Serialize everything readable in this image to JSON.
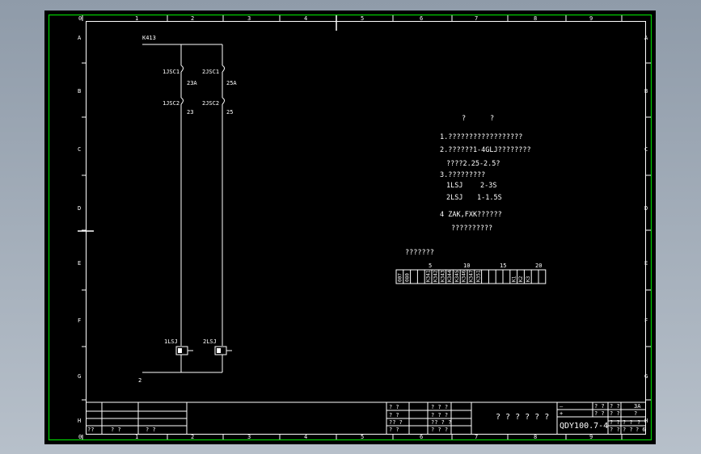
{
  "drawing": {
    "border_color": "#00c800",
    "line_color": "#ffffff",
    "background": "#000000",
    "col_numbers_top": [
      "0",
      "1",
      "2",
      "3",
      "4",
      "5",
      "6",
      "7",
      "8",
      "9"
    ],
    "col_numbers_bottom": [
      "0",
      "1",
      "2",
      "3",
      "4",
      "5",
      "6",
      "7",
      "8",
      "9"
    ],
    "row_letters_left": [
      "A",
      "B",
      "C",
      "D",
      "E",
      "F",
      "G",
      "H"
    ],
    "row_letters_right": [
      "A",
      "B",
      "C",
      "D",
      "E",
      "F",
      "G",
      "H"
    ]
  },
  "circuit": {
    "bus_label": "K413",
    "contacts": [
      {
        "top": "1JSC1",
        "top_num": "23A",
        "bottom": "1JSC2",
        "bottom_num": "23"
      },
      {
        "top": "2JSC1",
        "top_num": "25A",
        "bottom": "2JSC2",
        "bottom_num": "25"
      }
    ],
    "coils": [
      "1LSJ",
      "2LSJ"
    ],
    "return_label": "2"
  },
  "notes": {
    "header_left": "?",
    "header_right": "?",
    "line1": "1.??????????????????",
    "line2": "2.??????1-4GLJ????????",
    "line2b": "????2.25-2.5?",
    "line3": "3.?????????",
    "timing": [
      {
        "name": "1LSJ",
        "value": "2-3S"
      },
      {
        "name": "2LSJ",
        "value": "1-1.5S"
      }
    ],
    "line4": "4 ZAK,FXK??????",
    "line4b": "??????????"
  },
  "terminal_strip": {
    "title": "???????",
    "scale": [
      "5",
      "10",
      "15",
      "20"
    ],
    "cells": [
      "007",
      "080",
      "",
      "",
      "K341",
      "K342",
      "K343",
      "K344",
      "K345",
      "K346",
      "K347",
      "K351",
      "",
      "",
      "",
      "",
      "K1",
      "K2",
      "K3",
      "",
      ""
    ]
  },
  "title_block": {
    "left_row": [
      "??",
      "? ?",
      "? ?"
    ],
    "mid_labels_a": [
      "? ?",
      "? ?",
      "?? ?",
      "? ?"
    ],
    "mid_labels_b": [
      "? ? ?",
      "? ? ?",
      "?? ? ?",
      "? ? ?"
    ],
    "name": "? ? ? ? ? ?",
    "drawing_number": "QDY100.7-4",
    "right_top": [
      "—",
      "? ?",
      "? ?",
      "3A"
    ],
    "right_row2": [
      "+",
      "? ?",
      "? ?",
      "?"
    ],
    "right_small": [
      "? ?",
      "? ?",
      "?"
    ],
    "right_bottom": [
      "? ?",
      "? ?",
      "? 6"
    ]
  }
}
